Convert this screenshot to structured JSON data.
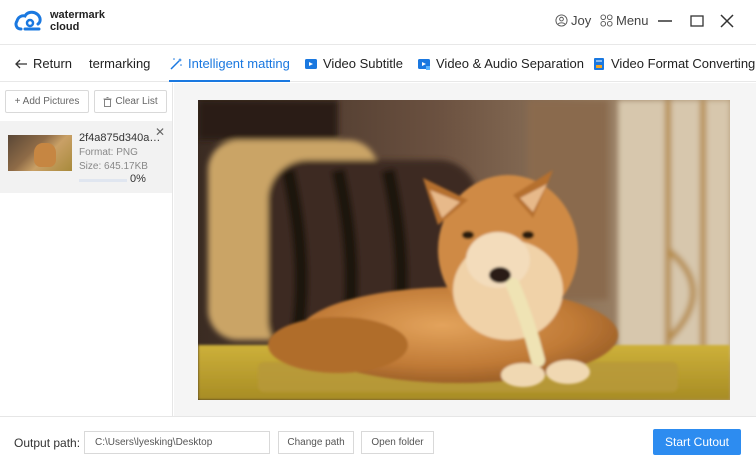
{
  "app": {
    "brand_line1": "watermark",
    "brand_line2": "cloud",
    "user_name": "Joy",
    "menu_label": "Menu",
    "accent": "#1a78e0",
    "button_blue": "#2d8cf0"
  },
  "tabs": [
    {
      "label": "Return",
      "icon": "arrow-left-icon"
    },
    {
      "label": "termarking",
      "icon": ""
    },
    {
      "label": "Intelligent matting",
      "icon": "magic-wand-icon",
      "active": true
    },
    {
      "label": "Video Subtitle",
      "icon": "video-subtitle-icon"
    },
    {
      "label": "Video & Audio Separation",
      "icon": "video-audio-icon"
    },
    {
      "label": "Video Format Converting",
      "icon": "video-format-icon"
    }
  ],
  "sidebar": {
    "add_pictures": "+ Add Pictures",
    "clear_list": "Clear List",
    "files": [
      {
        "name": "2f4a875d340a25...",
        "format": "Format:  PNG",
        "size": "Size:  645.17KB",
        "progress_text": "0%",
        "progress": 0.0
      }
    ]
  },
  "bottom": {
    "output_label": "Output path:",
    "output_value": "C:\\Users\\lyesking\\Desktop",
    "change_path": "Change path",
    "open_folder": "Open folder",
    "start": "Start Cutout"
  }
}
